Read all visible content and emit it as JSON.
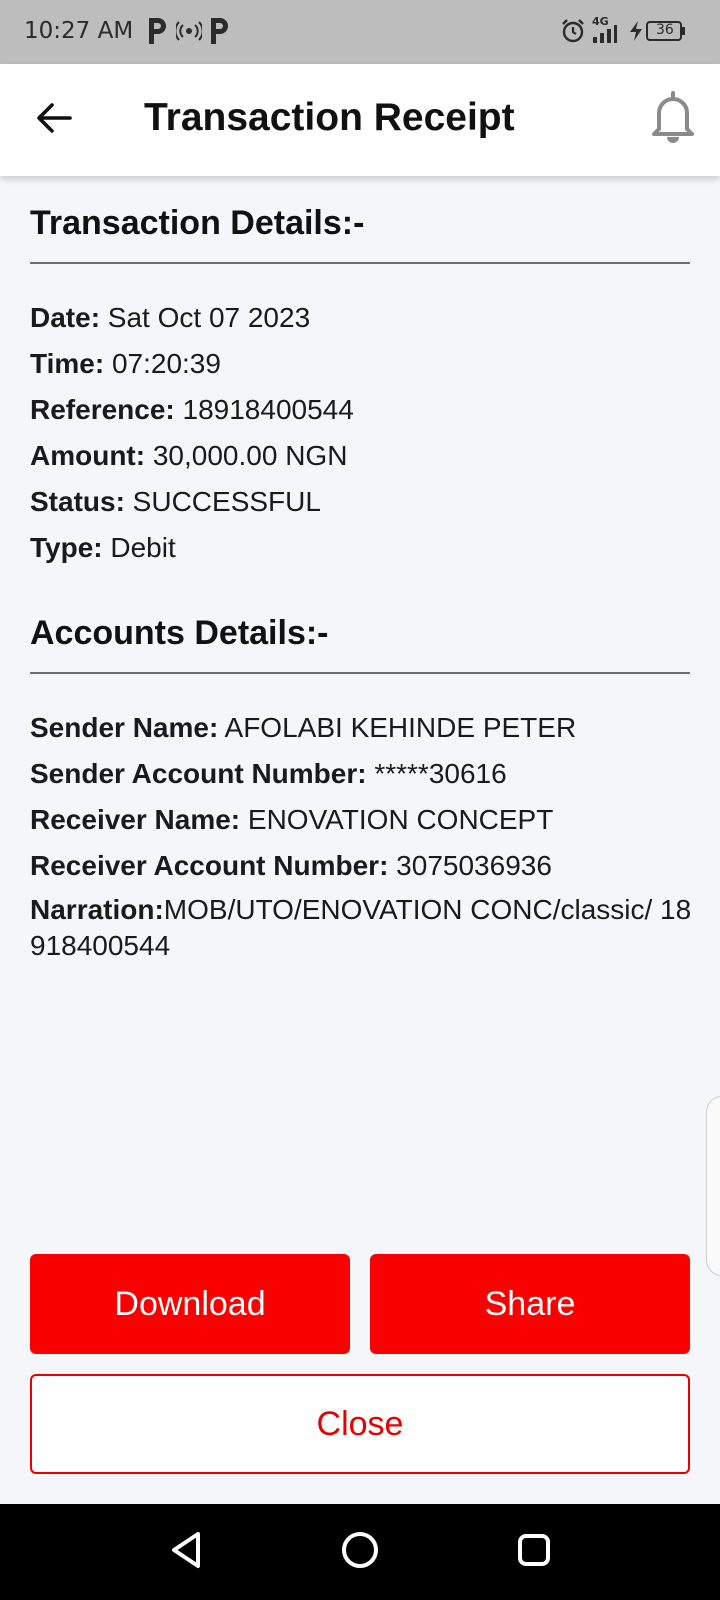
{
  "status_bar": {
    "time": "10:27 AM",
    "network_label": "4G",
    "battery": "36",
    "icons": [
      "parking-icon",
      "hotspot-icon",
      "parking-icon",
      "alarm-icon",
      "signal-icon",
      "charging-icon",
      "battery-icon"
    ]
  },
  "app_bar": {
    "title": "Transaction Receipt",
    "back_icon": "arrow-left-icon",
    "notification_icon": "bell-icon"
  },
  "transaction": {
    "heading": "Transaction Details:-",
    "fields": [
      {
        "label": "Date:",
        "value": " Sat Oct 07 2023"
      },
      {
        "label": "Time:",
        "value": " 07:20:39"
      },
      {
        "label": "Reference:",
        "value": " 18918400544"
      },
      {
        "label": "Amount:",
        "value": " 30,000.00 NGN"
      },
      {
        "label": "Status:",
        "value": " SUCCESSFUL"
      },
      {
        "label": "Type:",
        "value": " Debit"
      }
    ]
  },
  "accounts": {
    "heading": "Accounts Details:-",
    "fields": [
      {
        "label": "Sender Name:",
        "value": " AFOLABI KEHINDE PETER"
      },
      {
        "label": "Sender Account Number:",
        "value": " *****30616"
      },
      {
        "label": "Receiver Name:",
        "value": " ENOVATION CONCEPT"
      },
      {
        "label": "Receiver Account Number:",
        "value": " 3075036936"
      }
    ],
    "narration_label": "Narration:",
    "narration_value": "MOB/UTO/ENOVATION CONC/classic/ 18918400544"
  },
  "actions": {
    "download_label": "Download",
    "share_label": "Share",
    "close_label": "Close"
  },
  "colors": {
    "accent": "#fa0000",
    "background": "#f5f6f9",
    "status_bar": "#bdbdbd"
  },
  "nav_bar": {
    "icons": [
      "back-triangle-icon",
      "home-circle-icon",
      "recents-square-icon"
    ]
  }
}
